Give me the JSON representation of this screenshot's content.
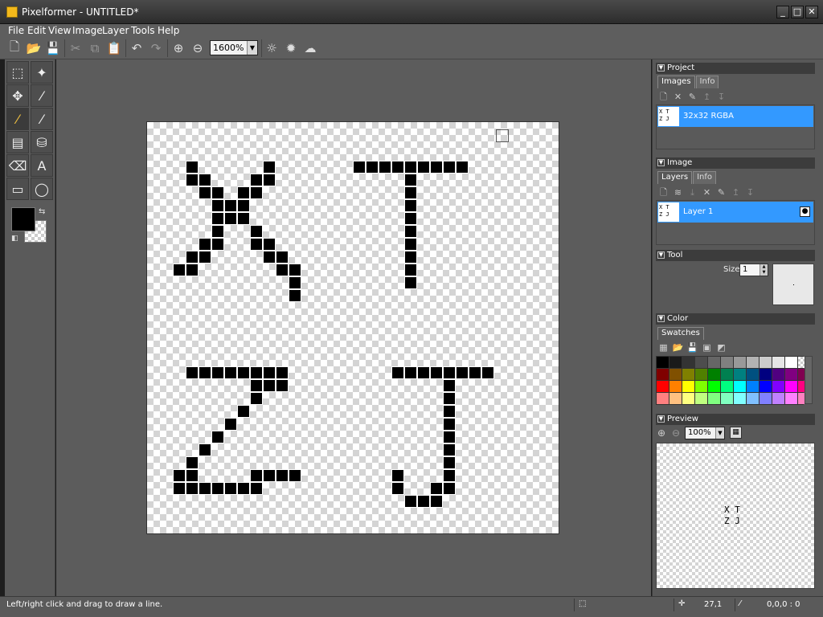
{
  "window": {
    "title": "Pixelformer - UNTITLED*",
    "controls": [
      "_",
      "□",
      "✕"
    ]
  },
  "menu": [
    "File",
    "Edit",
    "View",
    "Image",
    "Layer",
    "Tools",
    "Help"
  ],
  "toolbar": {
    "zoom": "1600%"
  },
  "project_panel": {
    "header": "Project",
    "tabs": [
      "Images",
      "Info"
    ],
    "image_label": "32x32 RGBA",
    "thumb_lines": [
      "X T",
      "Z J"
    ]
  },
  "image_panel": {
    "header": "Image",
    "tabs": [
      "Layers",
      "Info"
    ],
    "layer_label": "Layer 1"
  },
  "tool_panel": {
    "header": "Tool",
    "size_label": "Size:",
    "size_value": "1"
  },
  "color_panel": {
    "header": "Color",
    "tab": "Swatches",
    "swatches": [
      "#000000",
      "#1a1a1a",
      "#333333",
      "#4d4d4d",
      "#666666",
      "#808080",
      "#999999",
      "#b3b3b3",
      "#cccccc",
      "#e6e6e6",
      "#ffffff",
      "transparent",
      "#800000",
      "#805000",
      "#808000",
      "#508000",
      "#008000",
      "#008050",
      "#008080",
      "#005080",
      "#000080",
      "#500080",
      "#800080",
      "#800050",
      "#ff0000",
      "#ff8000",
      "#ffff00",
      "#80ff00",
      "#00ff00",
      "#00ff80",
      "#00ffff",
      "#0080ff",
      "#0000ff",
      "#8000ff",
      "#ff00ff",
      "#ff0080",
      "#ff8080",
      "#ffc080",
      "#ffff80",
      "#c0ff80",
      "#80ff80",
      "#80ffc0",
      "#80ffff",
      "#80c0ff",
      "#8080ff",
      "#c080ff",
      "#ff80ff",
      "#ff80c0"
    ]
  },
  "preview_panel": {
    "header": "Preview",
    "zoom": "100%",
    "text_lines": [
      "X T",
      "Z J"
    ]
  },
  "status": {
    "message": "Left/right click and drag to draw a line.",
    "coords": "27,1",
    "color": "0,0,0 : 0"
  },
  "canvas": {
    "zoom_factor": 16,
    "pixels": [
      [
        3,
        3
      ],
      [
        9,
        3
      ],
      [
        3,
        4
      ],
      [
        4,
        4
      ],
      [
        8,
        4
      ],
      [
        9,
        4
      ],
      [
        4,
        5
      ],
      [
        5,
        5
      ],
      [
        7,
        5
      ],
      [
        8,
        5
      ],
      [
        5,
        6
      ],
      [
        6,
        6
      ],
      [
        7,
        6
      ],
      [
        5,
        7
      ],
      [
        6,
        7
      ],
      [
        7,
        7
      ],
      [
        5,
        8
      ],
      [
        8,
        8
      ],
      [
        4,
        9
      ],
      [
        5,
        9
      ],
      [
        8,
        9
      ],
      [
        9,
        9
      ],
      [
        3,
        10
      ],
      [
        4,
        10
      ],
      [
        9,
        10
      ],
      [
        10,
        10
      ],
      [
        2,
        11
      ],
      [
        3,
        11
      ],
      [
        10,
        11
      ],
      [
        11,
        11
      ],
      [
        11,
        12
      ],
      [
        11,
        13
      ],
      [
        16,
        3
      ],
      [
        17,
        3
      ],
      [
        18,
        3
      ],
      [
        19,
        3
      ],
      [
        20,
        3
      ],
      [
        21,
        3
      ],
      [
        22,
        3
      ],
      [
        23,
        3
      ],
      [
        24,
        3
      ],
      [
        20,
        4
      ],
      [
        20,
        5
      ],
      [
        20,
        6
      ],
      [
        20,
        7
      ],
      [
        20,
        8
      ],
      [
        20,
        9
      ],
      [
        20,
        10
      ],
      [
        20,
        11
      ],
      [
        20,
        12
      ],
      [
        3,
        19
      ],
      [
        4,
        19
      ],
      [
        5,
        19
      ],
      [
        6,
        19
      ],
      [
        7,
        19
      ],
      [
        8,
        19
      ],
      [
        9,
        19
      ],
      [
        10,
        19
      ],
      [
        10,
        20
      ],
      [
        8,
        20
      ],
      [
        9,
        20
      ],
      [
        8,
        21
      ],
      [
        7,
        22
      ],
      [
        6,
        23
      ],
      [
        5,
        24
      ],
      [
        4,
        25
      ],
      [
        3,
        26
      ],
      [
        2,
        27
      ],
      [
        3,
        27
      ],
      [
        8,
        27
      ],
      [
        9,
        27
      ],
      [
        10,
        27
      ],
      [
        11,
        27
      ],
      [
        2,
        28
      ],
      [
        3,
        28
      ],
      [
        4,
        28
      ],
      [
        5,
        28
      ],
      [
        6,
        28
      ],
      [
        7,
        28
      ],
      [
        8,
        28
      ],
      [
        19,
        19
      ],
      [
        20,
        19
      ],
      [
        21,
        19
      ],
      [
        22,
        19
      ],
      [
        23,
        19
      ],
      [
        24,
        19
      ],
      [
        25,
        19
      ],
      [
        26,
        19
      ],
      [
        23,
        20
      ],
      [
        23,
        21
      ],
      [
        23,
        22
      ],
      [
        23,
        23
      ],
      [
        23,
        24
      ],
      [
        23,
        25
      ],
      [
        23,
        26
      ],
      [
        23,
        27
      ],
      [
        19,
        27
      ],
      [
        19,
        28
      ],
      [
        22,
        28
      ],
      [
        23,
        28
      ],
      [
        20,
        29
      ],
      [
        21,
        29
      ],
      [
        22,
        29
      ]
    ]
  }
}
